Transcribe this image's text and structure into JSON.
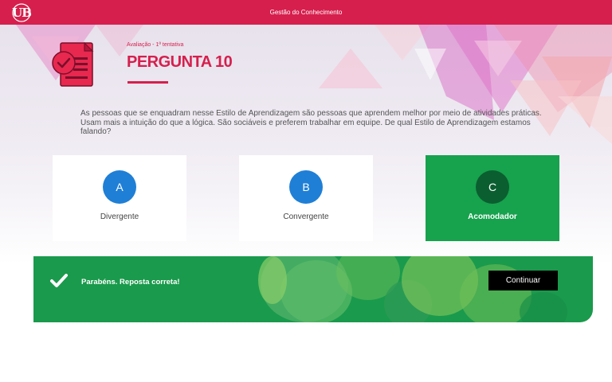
{
  "header": {
    "logo_text": "UB",
    "title": "Gestão do Conhecimento"
  },
  "question": {
    "breadcrumb": "Avaliação - 1ª tentativa",
    "title": "PERGUNTA 10",
    "text": "As pessoas que se enquadram nesse Estilo de Aprendizagem são pessoas que aprendem melhor por meio de atividades práticas. Usam mais a intuição do que a lógica. São sociáveis e preferem trabalhar em equipe. De qual Estilo de Aprendizagem estamos falando?"
  },
  "options": [
    {
      "letter": "A",
      "label": "Divergente",
      "selected": false
    },
    {
      "letter": "B",
      "label": "Convergente",
      "selected": false
    },
    {
      "letter": "C",
      "label": "Acomodador",
      "selected": true
    }
  ],
  "feedback": {
    "message": "Parabéns. Reposta correta!",
    "continue_label": "Continuar",
    "icon": "check-icon"
  },
  "colors": {
    "brand": "#d61f4d",
    "option_circle": "#1f7fd6",
    "correct": "#17a24e",
    "correct_dark": "#0b5e2f",
    "feedback_bg": "#1a9a4c"
  }
}
